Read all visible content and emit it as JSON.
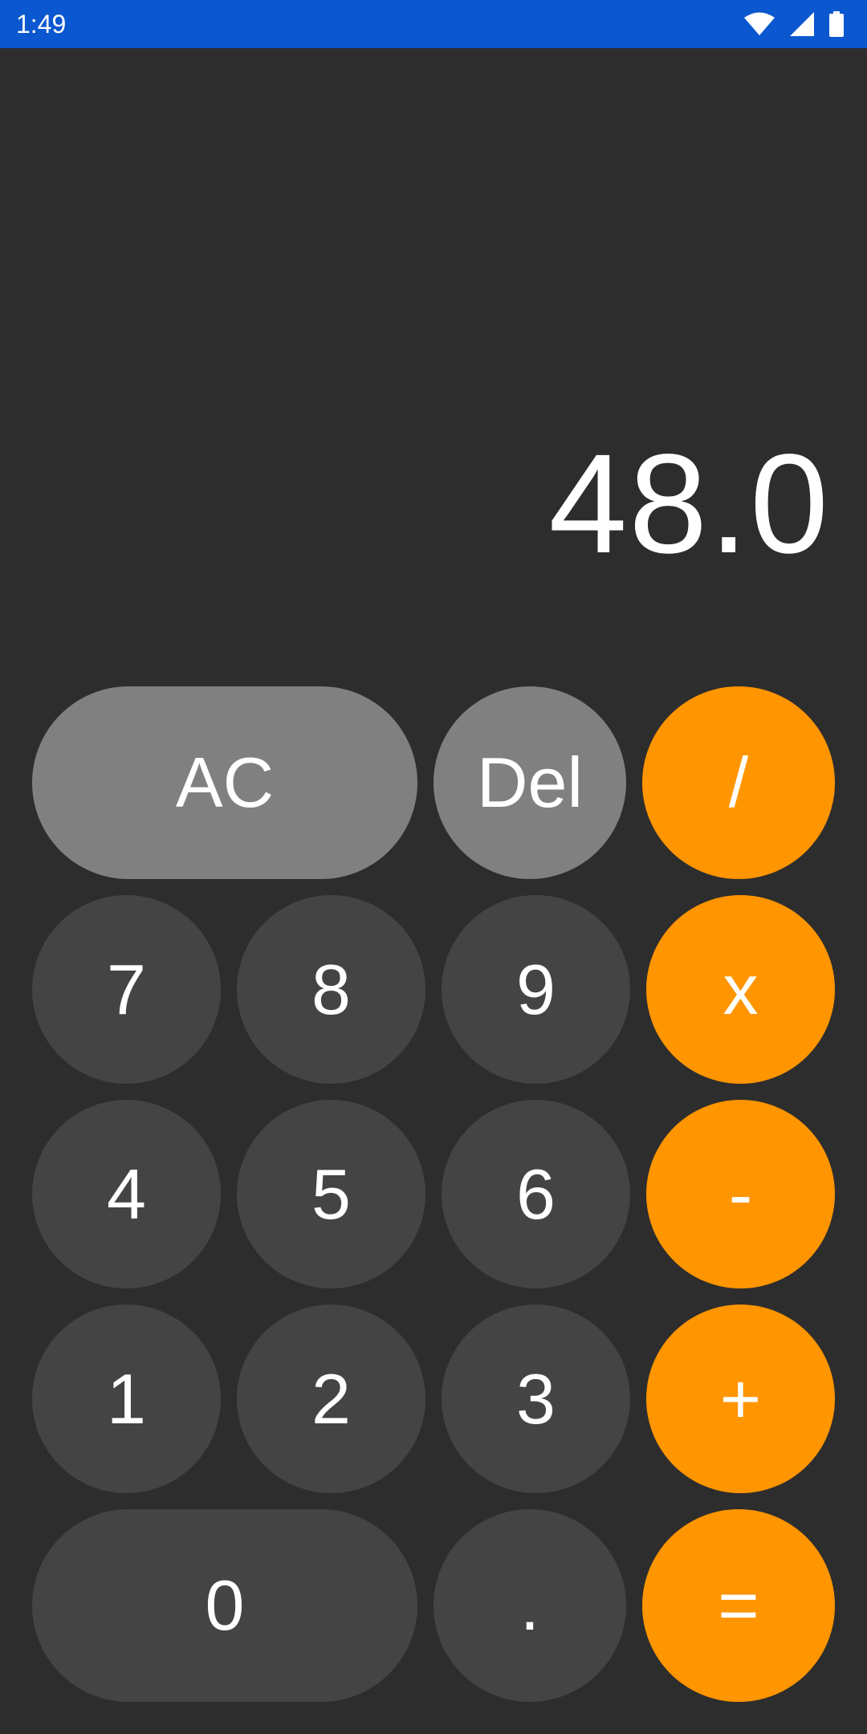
{
  "status_bar": {
    "time": "1:49",
    "icons": [
      "wifi-icon",
      "cell-signal-icon",
      "battery-icon"
    ],
    "background": "#0b57d0"
  },
  "display": {
    "value": "48.0"
  },
  "colors": {
    "background": "#2d2d2d",
    "digit_key": "#444444",
    "function_key": "#808080",
    "operator_key": "#ff9500",
    "text": "#ffffff"
  },
  "keys": {
    "clear": "AC",
    "delete": "Del",
    "divide": "/",
    "multiply": "x",
    "subtract": "-",
    "add": "+",
    "equals": "=",
    "decimal": ".",
    "d0": "0",
    "d1": "1",
    "d2": "2",
    "d3": "3",
    "d4": "4",
    "d5": "5",
    "d6": "6",
    "d7": "7",
    "d8": "8",
    "d9": "9"
  }
}
